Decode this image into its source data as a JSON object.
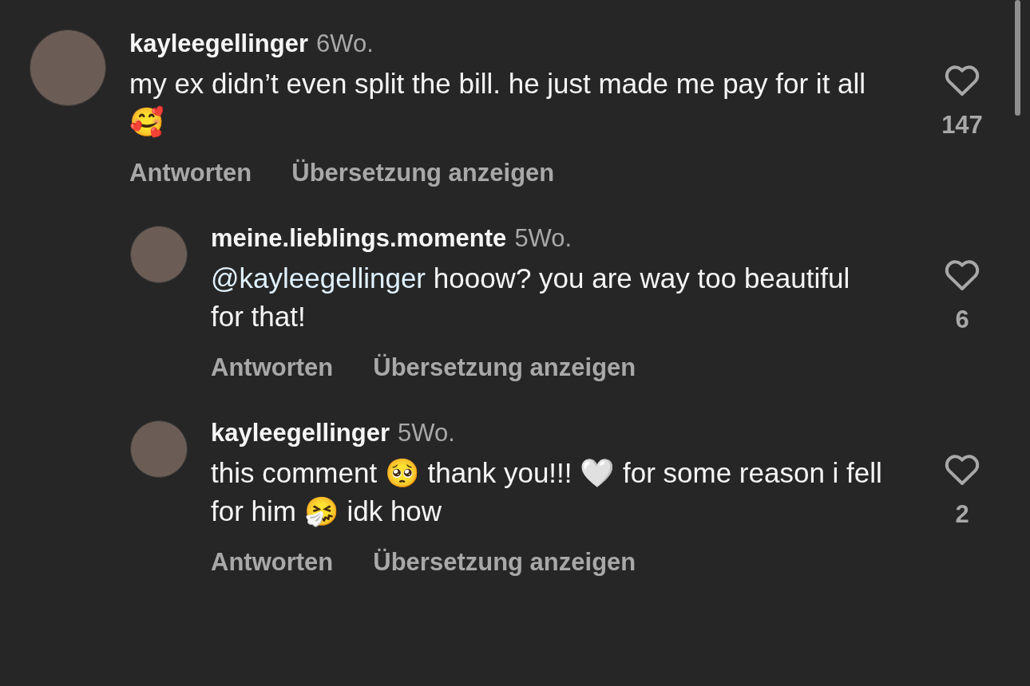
{
  "comments": [
    {
      "kind": "comment",
      "username": "kayleegellinger",
      "time": "6Wo.",
      "text": "my ex didn’t even split the bill. he just made me pay for it all 🥰",
      "likes": "147",
      "actions": [
        "Antworten",
        "Übersetzung anzeigen"
      ]
    },
    {
      "kind": "reply",
      "username": "meine.lieblings.momente",
      "time": "5Wo.",
      "mention": "@kayleegellinger",
      "text": "hooow? you are way too beautiful for that!",
      "likes": "6",
      "actions": [
        "Antworten",
        "Übersetzung anzeigen"
      ]
    },
    {
      "kind": "reply",
      "username": "kayleegellinger",
      "time": "5Wo.",
      "text": "this comment 🥺 thank you!!! 🤍 for some reason i fell for him 🤧 idk how",
      "likes": "2",
      "actions": [
        "Antworten",
        "Übersetzung anzeigen"
      ]
    }
  ]
}
